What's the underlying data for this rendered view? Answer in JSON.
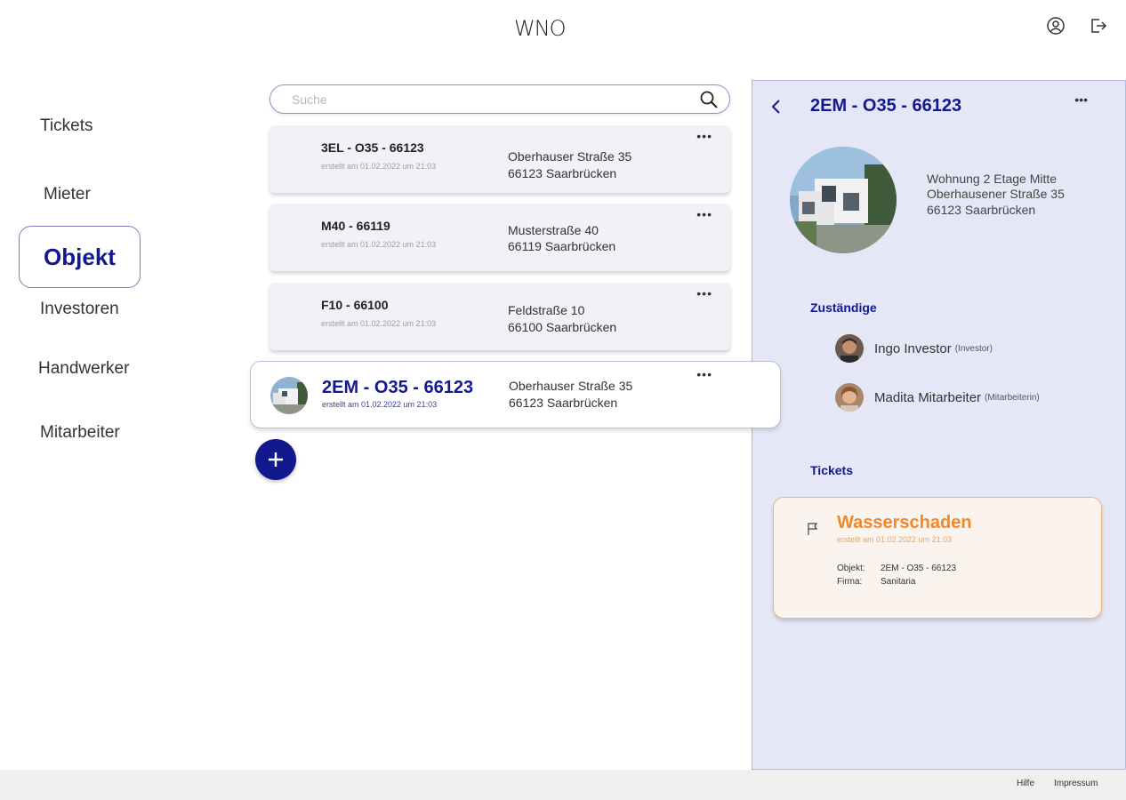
{
  "header": {
    "logo": "WNO"
  },
  "sidebar": {
    "items": [
      {
        "label": "Tickets"
      },
      {
        "label": "Mieter"
      },
      {
        "label": "Objekt"
      },
      {
        "label": "Investoren"
      },
      {
        "label": "Handwerker"
      },
      {
        "label": "Mitarbeiter"
      }
    ]
  },
  "search": {
    "placeholder": "Suche",
    "value": ""
  },
  "objects": [
    {
      "code": "3EL - O35 - 66123",
      "created": "erstellt am 01.02.2022 um 21:03",
      "street": "Oberhauser Straße 35",
      "city": "66123 Saarbrücken"
    },
    {
      "code": "M40 - 66119",
      "created": "erstellt am 01.02.2022 um 21:03",
      "street": "Musterstraße 40",
      "city": "66119 Saarbrücken"
    },
    {
      "code": "F10 - 66100",
      "created": "erstellt am 01.02.2022 um 21:03",
      "street": "Feldstraße 10",
      "city": "66100 Saarbrücken"
    },
    {
      "code": "2EM - O35 - 66123",
      "created": "erstellt am 01.02.2022 um 21:03",
      "street": "Oberhauser Straße 35",
      "city": "66123 Saarbrücken"
    }
  ],
  "detail": {
    "title": "2EM - O35 - 66123",
    "description": [
      "Wohnung 2 Etage Mitte",
      "Oberhausener Straße 35",
      "66123 Saarbrücken"
    ],
    "responsible_heading": "Zuständige",
    "persons": [
      {
        "name": "Ingo Investor",
        "role": "(Investor)"
      },
      {
        "name": "Madita Mitarbeiter",
        "role": "(Mitarbeiterin)"
      }
    ],
    "tickets_heading": "Tickets",
    "ticket": {
      "title": "Wasserschaden",
      "created": "erstellt am 01.02.2022 um 21:03",
      "object_label": "Objekt:",
      "object_value": "2EM - O35 - 66123",
      "company_label": "Firma:",
      "company_value": "Sanitaria"
    }
  },
  "footer": {
    "help": "Hilfe",
    "imprint": "Impressum"
  },
  "colors": {
    "primary": "#12198f",
    "panel_bg": "#e6e7f6",
    "ticket_accent": "#f0882b"
  }
}
